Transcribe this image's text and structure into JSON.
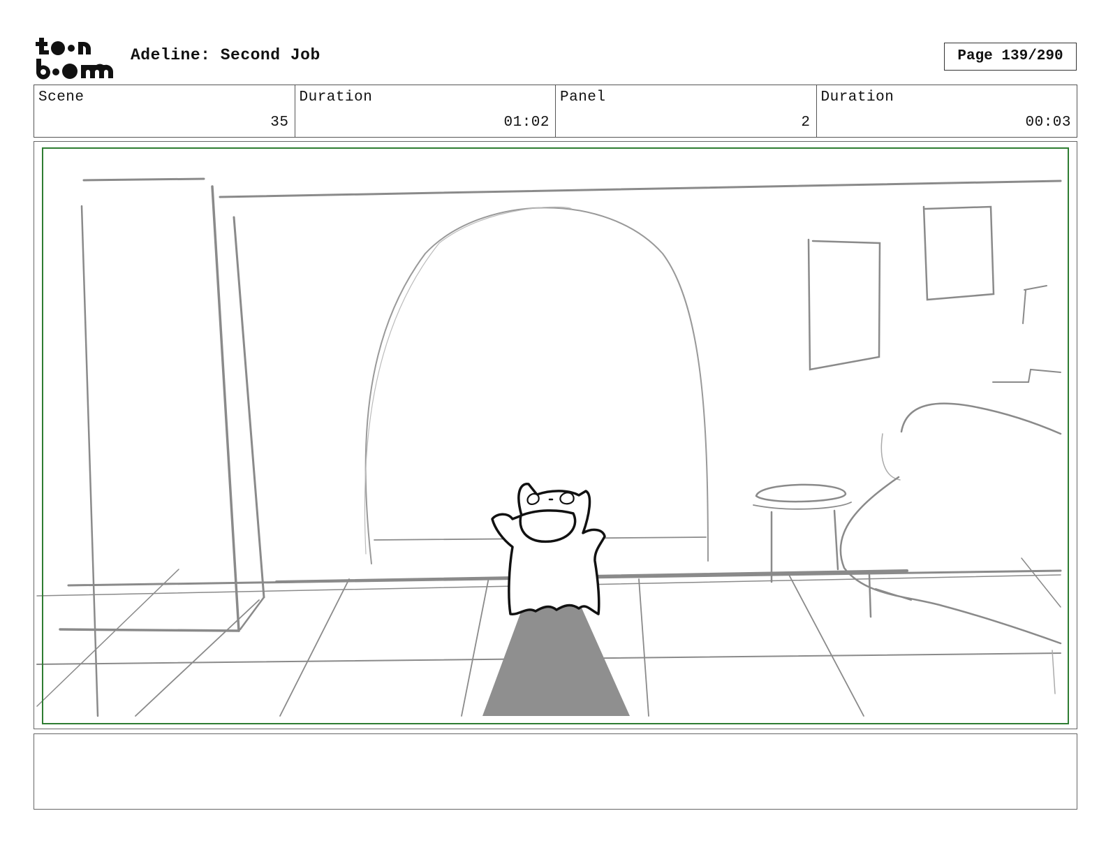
{
  "header": {
    "logo_text_top": "toon",
    "logo_text_bottom": "boom",
    "project_title": "Adeline: Second Job",
    "page_label": "Page 139/290"
  },
  "info": {
    "scene_label": "Scene",
    "scene_value": "35",
    "scene_duration_label": "Duration",
    "scene_duration_value": "01:02",
    "panel_label": "Panel",
    "panel_value": "2",
    "panel_duration_label": "Duration",
    "panel_duration_value": "00:03"
  },
  "colors": {
    "safe_frame": "#2e7d32",
    "sketch_line": "#8a8a8a",
    "shadow_fill": "#8f8f8f",
    "character_line": "#111111"
  },
  "notes": {
    "text": ""
  }
}
